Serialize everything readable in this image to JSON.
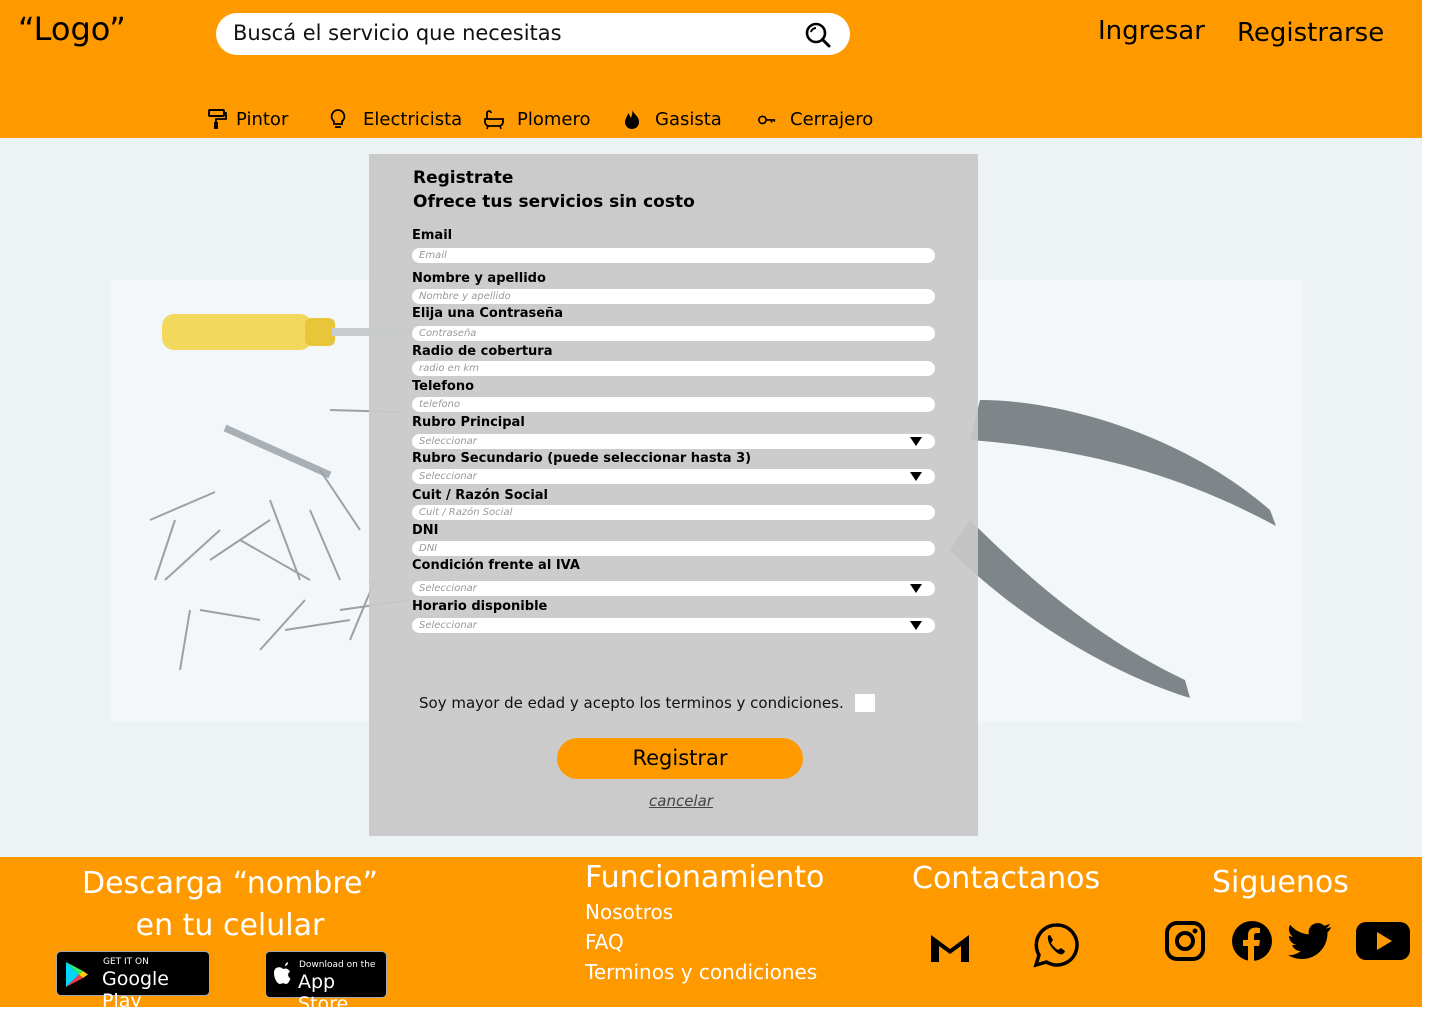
{
  "header": {
    "logo": "“Logo”",
    "search_placeholder": "Buscá el servicio que necesitas",
    "login": "Ingresar",
    "signup": "Registrarse"
  },
  "categories": [
    {
      "label": "Pintor",
      "icon": "paint-roller-icon"
    },
    {
      "label": "Electricista",
      "icon": "lightbulb-icon"
    },
    {
      "label": "Plomero",
      "icon": "bathtub-icon"
    },
    {
      "label": "Gasista",
      "icon": "flame-icon"
    },
    {
      "label": "Cerrajero",
      "icon": "key-icon"
    }
  ],
  "form": {
    "title": "Registrate",
    "subtitle": "Ofrece tus servicios sin costo",
    "fields": [
      {
        "label": "Email",
        "placeholder": "Email"
      },
      {
        "label": "Nombre y apellido",
        "placeholder": "Nombre y apellido"
      },
      {
        "label": "Elija una Contraseña",
        "placeholder": "Contraseña"
      },
      {
        "label": "Radio de cobertura",
        "placeholder": " radio en km"
      },
      {
        "label": "Telefono",
        "placeholder": "telefono"
      },
      {
        "label": "Rubro Principal",
        "placeholder": "Seleccionar"
      },
      {
        "label": "Rubro Secundario (puede seleccionar hasta 3)",
        "placeholder": "Seleccionar"
      },
      {
        "label": "Cuit / Razón Social",
        "placeholder": "Cuit / Razón Social"
      },
      {
        "label": "DNI",
        "placeholder": "DNI"
      },
      {
        "label": "Condición frente al IVA",
        "placeholder": "Seleccionar"
      },
      {
        "label": "Horario disponible",
        "placeholder": "Seleccionar"
      }
    ],
    "terms": "Soy mayor de edad y acepto los terminos y condiciones.",
    "submit": "Registrar",
    "cancel": "cancelar"
  },
  "footer": {
    "download_line1": "Descarga “nombre”",
    "download_line2": "en tu celular",
    "google_small": "GET IT ON",
    "google_big": "Google Play",
    "apple_small": "Download on the",
    "apple_big": "App Store",
    "func_title": "Funcionamiento",
    "links": [
      "Nosotros",
      "FAQ",
      "Terminos y condiciones"
    ],
    "contact_title": "Contactanos",
    "follow_title": "Siguenos"
  },
  "colors": {
    "brand": "#fe9a00",
    "panel": "#c8c8c8",
    "background": "#edf2f5"
  }
}
